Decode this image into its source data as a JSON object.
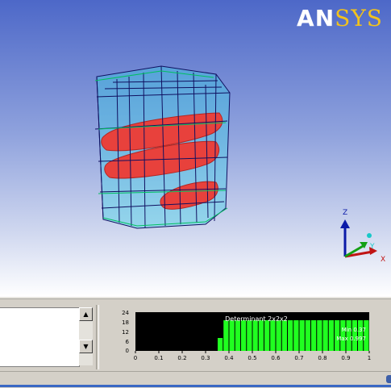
{
  "logo": {
    "part1": "AN",
    "part2": "SYS"
  },
  "triad": {
    "z_label": "Z",
    "y_label": "Y",
    "x_label": "X"
  },
  "colors": {
    "coil": "#e8413c",
    "mesh": "#000080",
    "fill": "#2fd6e8",
    "histo_bar": "#20ff20",
    "histo_bg": "#000000"
  },
  "message_box": {
    "text": ""
  },
  "chart_data": {
    "type": "bar",
    "title": "Determinant 2x2x2",
    "categories": [
      "0.35",
      "0.375",
      "0.4",
      "0.425",
      "0.45",
      "0.475",
      "0.5",
      "0.525",
      "0.55",
      "0.575",
      "0.6",
      "0.625",
      "0.65",
      "0.675",
      "0.7",
      "0.725",
      "0.75",
      "0.775",
      "0.8",
      "0.825",
      "0.85",
      "0.875",
      "0.9",
      "0.925",
      "0.95",
      "0.975"
    ],
    "values": [
      8,
      19,
      19,
      19,
      19,
      19,
      19,
      19,
      19,
      19,
      19,
      19,
      19,
      19,
      19,
      19,
      19,
      19,
      19,
      19,
      19,
      19,
      19,
      19,
      19,
      19
    ],
    "xlim": [
      0,
      1
    ],
    "ylim": [
      0,
      24
    ],
    "xticks": [
      "0",
      "0.1",
      "0.2",
      "0.3",
      "0.4",
      "0.5",
      "0.6",
      "0.7",
      "0.8",
      "0.9",
      "1"
    ],
    "yticks": [
      "0",
      "6",
      "12",
      "18",
      "24"
    ],
    "min_label": "Min 0.37",
    "max_label": "Max 0.997",
    "grid": false
  }
}
